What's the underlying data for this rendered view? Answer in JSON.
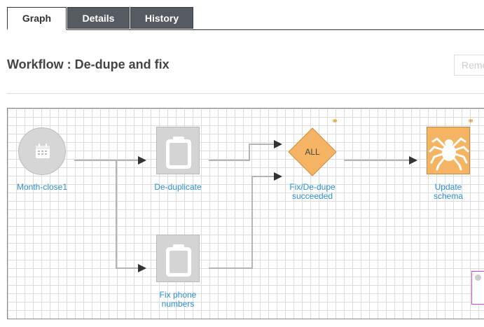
{
  "tabs": [
    {
      "label": "Graph",
      "active": true
    },
    {
      "label": "Details",
      "active": false
    },
    {
      "label": "History",
      "active": false
    }
  ],
  "header": {
    "title": "Workflow : De-dupe and fix",
    "remove_label": "Remove"
  },
  "graph": {
    "nodes": [
      {
        "id": "month-close1",
        "label": "Month-close1",
        "icon": "calendar-icon"
      },
      {
        "id": "de-duplicate",
        "label": "De-duplicate",
        "icon": "clipboard-icon"
      },
      {
        "id": "fix-phone-numbers",
        "label_lines": [
          "Fix phone",
          "numbers"
        ],
        "icon": "clipboard-icon"
      },
      {
        "id": "fix-dedupe-succeeded",
        "label_lines": [
          "Fix/De-dupe",
          "succeeded"
        ],
        "icon": "decision-diamond",
        "text": "ALL"
      },
      {
        "id": "update-schema",
        "label_lines": [
          "Update",
          "schema"
        ],
        "icon": "spider-icon"
      }
    ],
    "colors": {
      "node_gray": "#d6d6d6",
      "diamond_orange": "#f5b463",
      "label_blue": "#2b8fd6",
      "edge": "#b5b5b5"
    }
  }
}
